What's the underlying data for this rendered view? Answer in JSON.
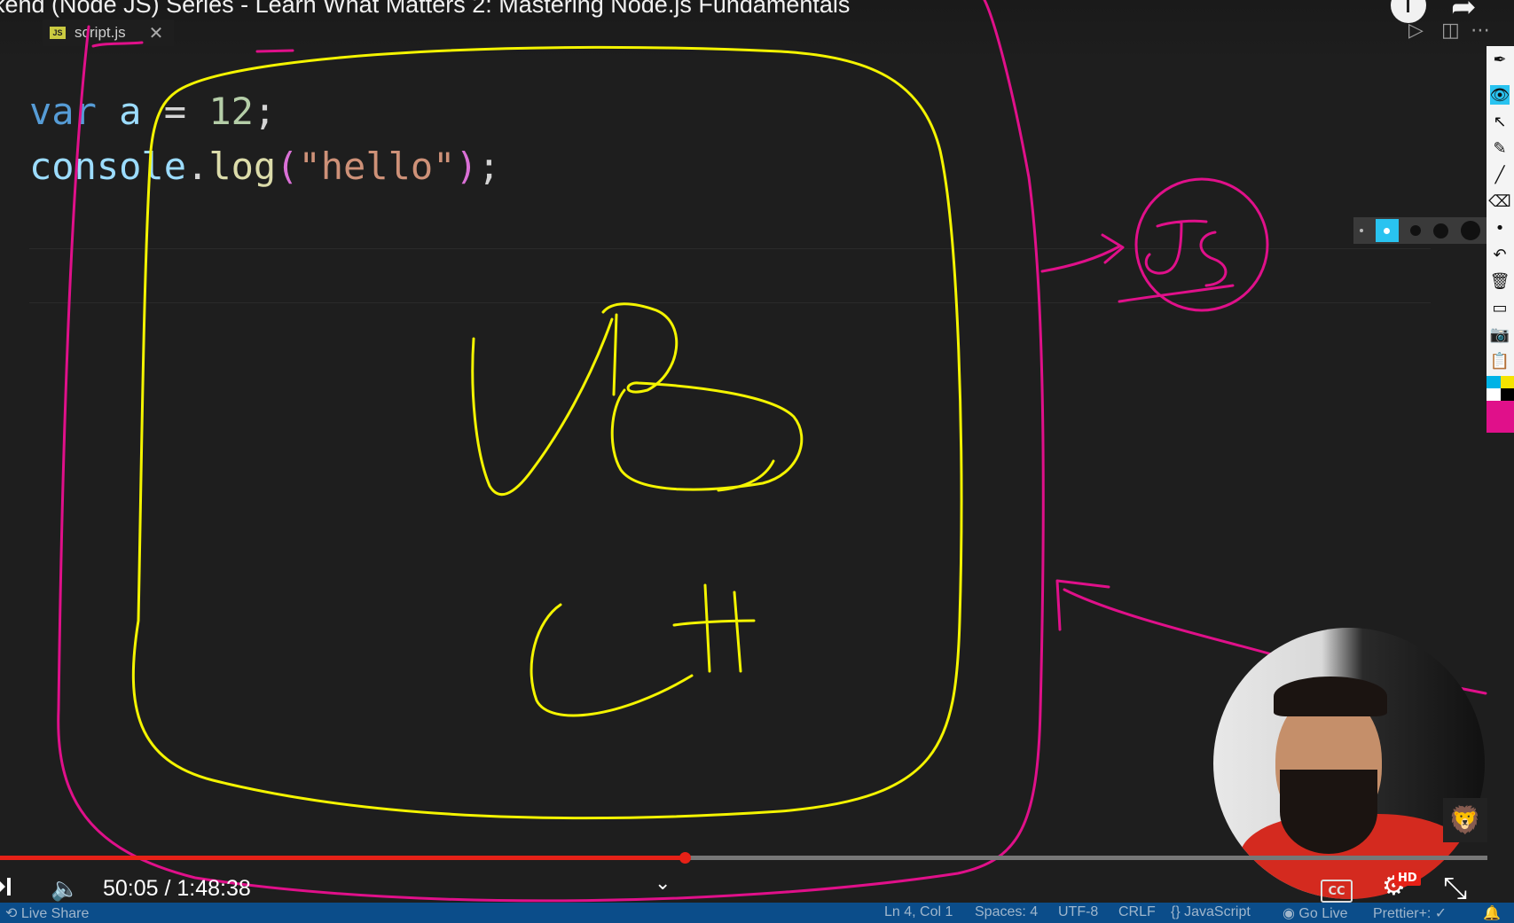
{
  "video": {
    "title": "kend (Node JS) Series - Learn What Matters 2: Mastering Node.js Fundamentals",
    "time_current": "50:05",
    "time_total": "1:48:38",
    "time_display": "50:05 / 1:48:38",
    "progress_fraction": 0.4605,
    "hd_badge": "HD",
    "cc_label": "CC"
  },
  "editor": {
    "tab_name": "script.js",
    "tab_badge": "JS",
    "code_lines": [
      "var a = 12;",
      "console.log(\"hello\");"
    ]
  },
  "annotations": {
    "handwritten": [
      "VB",
      "C++",
      "JS"
    ],
    "pen_colors": {
      "yellow": "#f4f400",
      "magenta": "#e0108a"
    }
  },
  "toolbar": {
    "tools": [
      "pen-icon",
      "eye-icon",
      "cursor-icon",
      "highlighter-icon",
      "line-icon",
      "eraser-icon",
      "dot-icon",
      "undo-icon",
      "trash-icon",
      "screen-icon",
      "camera-icon",
      "clipboard-icon"
    ],
    "palette": [
      "#00b3e6",
      "#f5e400",
      "#ffffff",
      "#000000",
      "#e0108a"
    ]
  },
  "status_bar": {
    "live_share": "Live Share",
    "position": "Ln 4, Col 1",
    "spaces": "Spaces: 4",
    "encoding": "UTF-8",
    "eol": "CRLF",
    "language": "{} JavaScript",
    "go_live": "Go Live",
    "prettier": "Prettier+: ✓"
  }
}
